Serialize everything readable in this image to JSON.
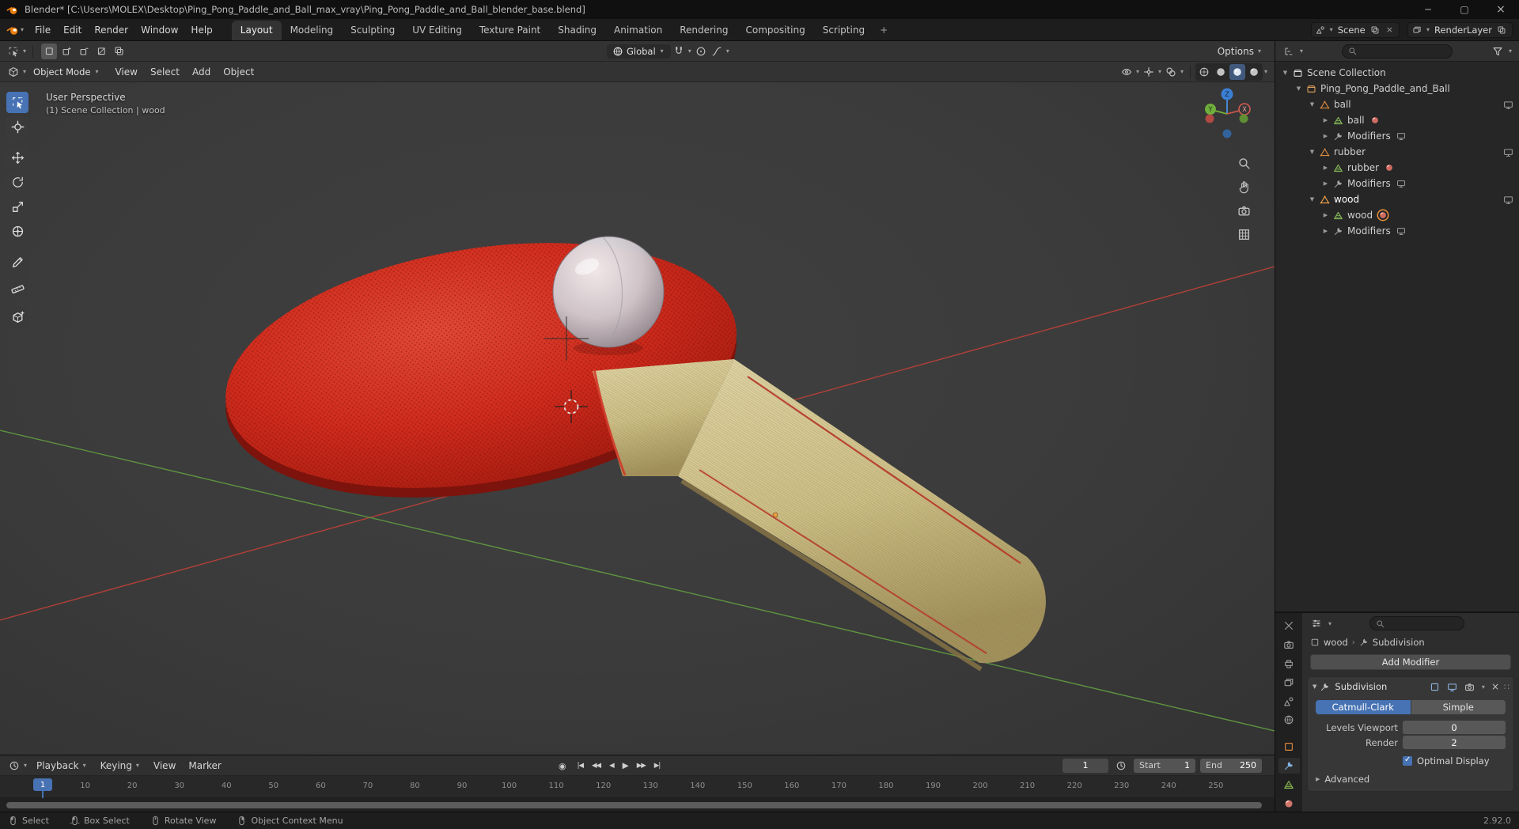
{
  "window": {
    "title": "Blender* [C:\\Users\\MOLEX\\Desktop\\Ping_Pong_Paddle_and_Ball_max_vray\\Ping_Pong_Paddle_and_Ball_blender_base.blend]",
    "controls": [
      "minimize",
      "maximize",
      "close"
    ]
  },
  "topbar": {
    "menus": [
      "File",
      "Edit",
      "Render",
      "Window",
      "Help"
    ],
    "workspace_tabs": [
      "Layout",
      "Modeling",
      "Sculpting",
      "UV Editing",
      "Texture Paint",
      "Shading",
      "Animation",
      "Rendering",
      "Compositing",
      "Scripting"
    ],
    "active_tab": "Layout",
    "add_workspace": "+",
    "scene_label": "Scene",
    "render_layer_label": "RenderLayer"
  },
  "tool_settings": {
    "select_modes": [
      "new",
      "extend",
      "subtract",
      "invert",
      "intersect"
    ],
    "active_select_mode": "new",
    "orientation_label": "Global",
    "options_label": "Options"
  },
  "toolbar": {
    "tools": [
      "select-box",
      "cursor",
      "move",
      "rotate",
      "scale",
      "transform",
      "annotate",
      "measure",
      "add-cube"
    ],
    "active_tool": "select-box"
  },
  "viewport": {
    "mode_label": "Object Mode",
    "menus": [
      "View",
      "Select",
      "Add",
      "Object"
    ],
    "overlay_line1": "User Perspective",
    "overlay_line2": "(1) Scene Collection | wood",
    "nav_icons": [
      "zoom",
      "hand",
      "camera",
      "grid"
    ],
    "shading_modes": [
      "wireframe",
      "solid",
      "material",
      "rendered"
    ],
    "active_shading": "material",
    "gizmo_axes": [
      "X",
      "Y",
      "Z"
    ]
  },
  "outliner": {
    "rows": [
      {
        "label": "Scene Collection",
        "icon": "scene-collection",
        "level": 0,
        "arrow": "down"
      },
      {
        "label": "Ping_Pong_Paddle_and_Ball",
        "icon": "collection",
        "level": 1,
        "arrow": "down"
      },
      {
        "label": "ball",
        "icon": "mesh-object",
        "level": 2,
        "arrow": "down",
        "right": "monitor"
      },
      {
        "label": "ball",
        "icon": "mesh-data",
        "level": 3,
        "arrow": "right",
        "extra": "material"
      },
      {
        "label": "Modifiers",
        "icon": "wrench",
        "level": 3,
        "arrow": "right",
        "extra": "monitor-small"
      },
      {
        "label": "rubber",
        "icon": "mesh-object",
        "level": 2,
        "arrow": "down",
        "right": "monitor"
      },
      {
        "label": "rubber",
        "icon": "mesh-data",
        "level": 3,
        "arrow": "right",
        "extra": "material"
      },
      {
        "label": "Modifiers",
        "icon": "wrench",
        "level": 3,
        "arrow": "right",
        "extra": "monitor-small"
      },
      {
        "label": "wood",
        "icon": "mesh-object",
        "level": 2,
        "arrow": "down",
        "right": "monitor",
        "active": true
      },
      {
        "label": "wood",
        "icon": "mesh-data",
        "level": 3,
        "arrow": "right",
        "extra": "material-selected"
      },
      {
        "label": "Modifiers",
        "icon": "wrench",
        "level": 3,
        "arrow": "right",
        "extra": "monitor-small"
      }
    ]
  },
  "properties": {
    "tabs": [
      {
        "name": "tool"
      },
      {
        "name": "render"
      },
      {
        "name": "output"
      },
      {
        "name": "view-layer"
      },
      {
        "name": "scene"
      },
      {
        "name": "world"
      },
      {
        "name": "object"
      },
      {
        "name": "modifiers"
      },
      {
        "name": "data"
      },
      {
        "name": "material"
      }
    ],
    "active_tab": "modifiers",
    "breadcrumb_object": "wood",
    "breadcrumb_modifier": "Subdivision",
    "add_modifier_label": "Add Modifier",
    "modifier": {
      "name": "Subdivision",
      "type_options": [
        "Catmull-Clark",
        "Simple"
      ],
      "active_type": "Catmull-Clark",
      "fields": [
        {
          "label": "Levels Viewport",
          "value": "0"
        },
        {
          "label": "Render",
          "value": "2"
        }
      ],
      "optimal_display_label": "Optimal Display",
      "optimal_display_checked": true,
      "advanced_label": "Advanced"
    }
  },
  "timeline": {
    "menus": [
      "Playback",
      "Keying",
      "View",
      "Marker"
    ],
    "transport": [
      "jump-start",
      "prev-keyframe",
      "play-reverse",
      "play",
      "next-keyframe",
      "jump-end"
    ],
    "current_frame": "1",
    "playhead_frame": 1,
    "start_label": "Start",
    "start_value": "1",
    "end_label": "End",
    "end_value": "250",
    "ruler_frames": [
      10,
      20,
      30,
      40,
      50,
      60,
      70,
      80,
      90,
      100,
      110,
      120,
      130,
      140,
      150,
      160,
      170,
      180,
      190,
      200,
      210,
      220,
      230,
      240,
      250
    ]
  },
  "status_bar": {
    "items": [
      {
        "icon": "mouse-left",
        "label": "Select"
      },
      {
        "icon": "mouse-left-drag",
        "label": "Box Select"
      },
      {
        "icon": "mouse-middle",
        "label": "Rotate View"
      },
      {
        "icon": "mouse-right",
        "label": "Object Context Menu"
      }
    ],
    "version": "2.92.0"
  },
  "colors": {
    "accent": "#4772b3",
    "object_orange": "#dd8a3d",
    "axis_x": "#b04038",
    "axis_y": "#5e9440",
    "axis_z": "#3b7fd4"
  }
}
